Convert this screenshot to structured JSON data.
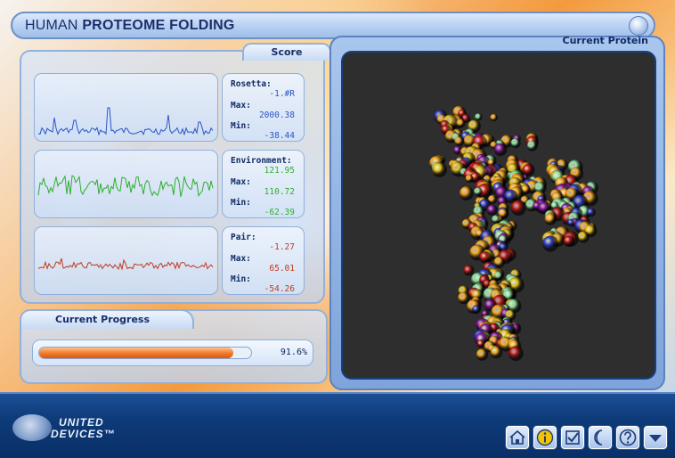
{
  "window": {
    "title_light": "HUMAN ",
    "title_bold": "PROTEOME FOLDING"
  },
  "score": {
    "label": "Score",
    "rows": [
      {
        "name": "Rosetta:",
        "value": "-1.#R",
        "max_label": "Max:",
        "max": "2000.38",
        "min_label": "Min:",
        "min": "-38.44",
        "color": "#2a55c8"
      },
      {
        "name": "Environment:",
        "value": "121.95",
        "max_label": "Max:",
        "max": "110.72",
        "min_label": "Min:",
        "min": "-62.39",
        "color": "#2fae2f"
      },
      {
        "name": "Pair:",
        "value": "-1.27",
        "max_label": "Max:",
        "max": "65.01",
        "min_label": "Min:",
        "min": "-54.26",
        "color": "#c03a1a"
      }
    ]
  },
  "progress": {
    "label": "Current Progress",
    "percent": 91.6,
    "percent_text": "91.6%"
  },
  "protein": {
    "label": "Current Protein"
  },
  "brand": {
    "line1": "UNITED",
    "line2": "DEVICES™"
  },
  "toolbar": {
    "buttons": [
      {
        "name": "home-button",
        "icon": "house-icon"
      },
      {
        "name": "info-button",
        "icon": "info-icon"
      },
      {
        "name": "check-button",
        "icon": "checkbox-icon"
      },
      {
        "name": "moon-button",
        "icon": "moon-icon"
      },
      {
        "name": "help-button",
        "icon": "question-icon"
      },
      {
        "name": "menu-down-button",
        "icon": "triangle-down-icon"
      }
    ]
  }
}
